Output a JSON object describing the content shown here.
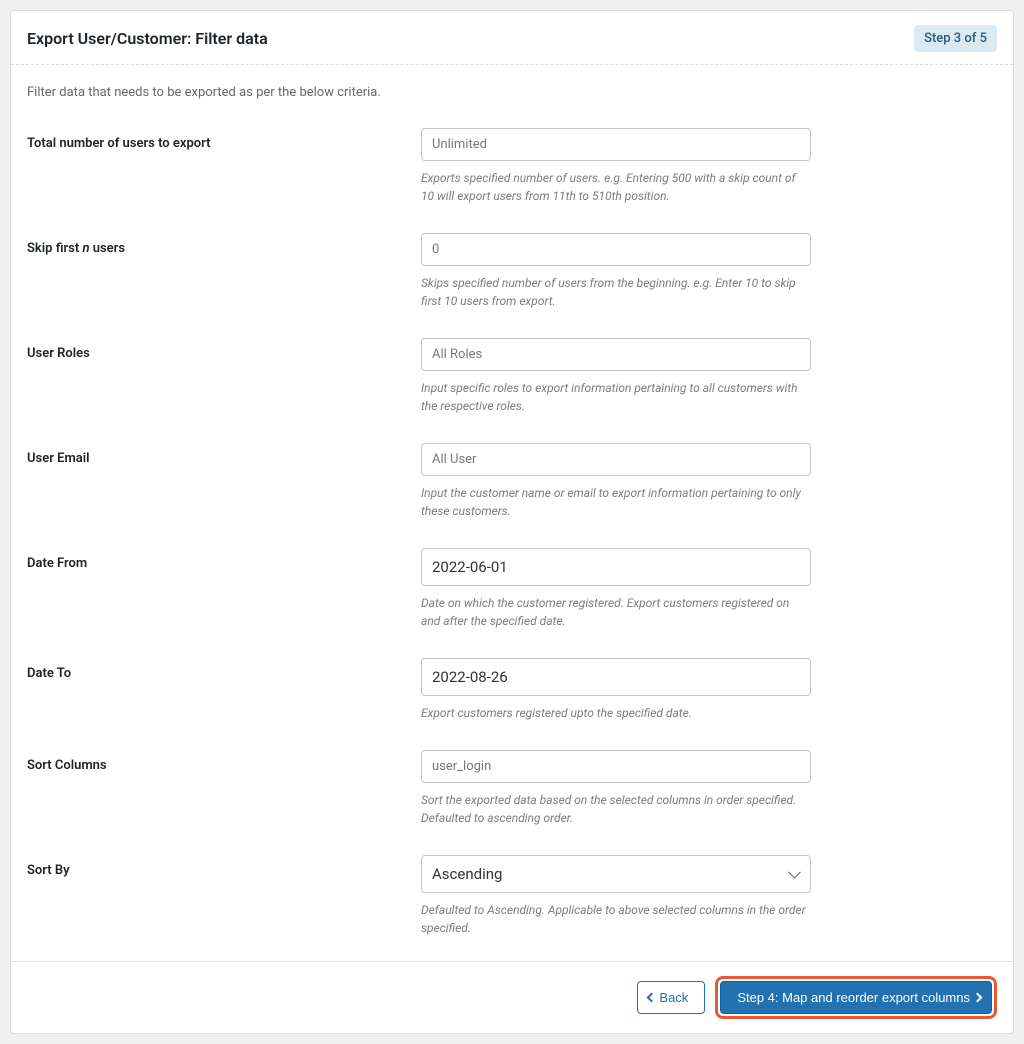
{
  "header": {
    "title": "Export User/Customer: Filter data",
    "step_badge": "Step 3 of 5"
  },
  "description": "Filter data that needs to be exported as per the below criteria.",
  "fields": {
    "total_users": {
      "label": "Total number of users to export",
      "placeholder": "Unlimited",
      "value": "",
      "help": "Exports specified number of users. e.g. Entering 500 with a skip count of 10 will export users from 11th to 510th position."
    },
    "skip": {
      "label_prefix": "Skip first ",
      "label_em": "n",
      "label_suffix": " users",
      "placeholder": "0",
      "value": "",
      "help": "Skips specified number of users from the beginning. e.g. Enter 10 to skip first 10 users from export."
    },
    "roles": {
      "label": "User Roles",
      "placeholder": "All Roles",
      "value": "",
      "help": "Input specific roles to export information pertaining to all customers with the respective roles."
    },
    "email": {
      "label": "User Email",
      "placeholder": "All User",
      "value": "",
      "help": "Input the customer name or email to export information pertaining to only these customers."
    },
    "date_from": {
      "label": "Date From",
      "value": "2022-06-01",
      "help": "Date on which the customer registered. Export customers registered on and after the specified date."
    },
    "date_to": {
      "label": "Date To",
      "value": "2022-08-26",
      "help": "Export customers registered upto the specified date."
    },
    "sort_columns": {
      "label": "Sort Columns",
      "placeholder": "user_login",
      "value": "",
      "help": "Sort the exported data based on the selected columns in order specified. Defaulted to ascending order."
    },
    "sort_by": {
      "label": "Sort By",
      "value": "Ascending",
      "help": "Defaulted to Ascending. Applicable to above selected columns in the order specified."
    }
  },
  "footer": {
    "back": "Back",
    "next": "Step 4: Map and reorder export columns"
  }
}
